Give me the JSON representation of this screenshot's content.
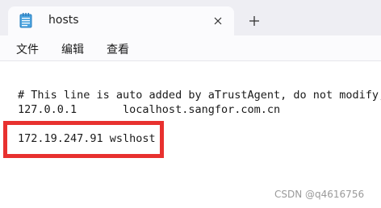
{
  "window": {
    "tab_title": "hosts",
    "new_tab_glyph": "+"
  },
  "menu": {
    "items": [
      "文件",
      "编辑",
      "查看"
    ]
  },
  "editor": {
    "lines": [
      "# This line is auto added by aTrustAgent, do not modify,",
      "127.0.0.1       localhost.sangfor.com.cn",
      "",
      "172.19.247.91 wslhost"
    ]
  },
  "watermark": "CSDN @q4616756",
  "colors": {
    "highlight": "#e8312f",
    "title_bar": "#eeeef3"
  },
  "icons": [
    "notepad-icon",
    "close-icon",
    "plus-icon"
  ]
}
